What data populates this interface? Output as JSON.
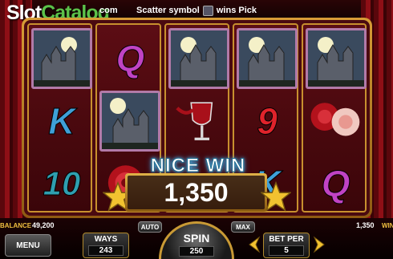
{
  "header": {
    "logo_slot": "Slot",
    "logo_catalog": "Catalog",
    "logo_com": "com",
    "scatter_text_before": "Scatter symbol",
    "scatter_text_after": "wins Pick"
  },
  "reels": {
    "reel1": [
      "castle",
      "K",
      "10"
    ],
    "reel2": [
      "Q",
      "castle",
      "rose"
    ],
    "reel3": [
      "castle",
      "wine",
      "blank"
    ],
    "reel4": [
      "castle",
      "9",
      "K"
    ],
    "reel5": [
      "castle",
      "roses-vampire",
      "Q"
    ]
  },
  "symbols": {
    "q": "Q",
    "k": "K",
    "ten": "10",
    "nine": "9"
  },
  "win": {
    "title": "NICE WIN",
    "amount": "1,350"
  },
  "controls": {
    "balance_label": "BALANCE",
    "balance_value": "49,200",
    "win_value": "1,350",
    "win_label": "WIN",
    "menu_label": "MENU",
    "ways_label": "WAYS",
    "ways_value": "243",
    "auto_label": "AUTO",
    "spin_label": "SPIN",
    "spin_value": "250",
    "max_label": "MAX",
    "bet_per_label": "BET PER",
    "bet_per_value": "5"
  },
  "colors": {
    "accent_gold": "#d79d36",
    "curtain_red": "#8e0f16",
    "logo_green": "#5cc24a"
  }
}
